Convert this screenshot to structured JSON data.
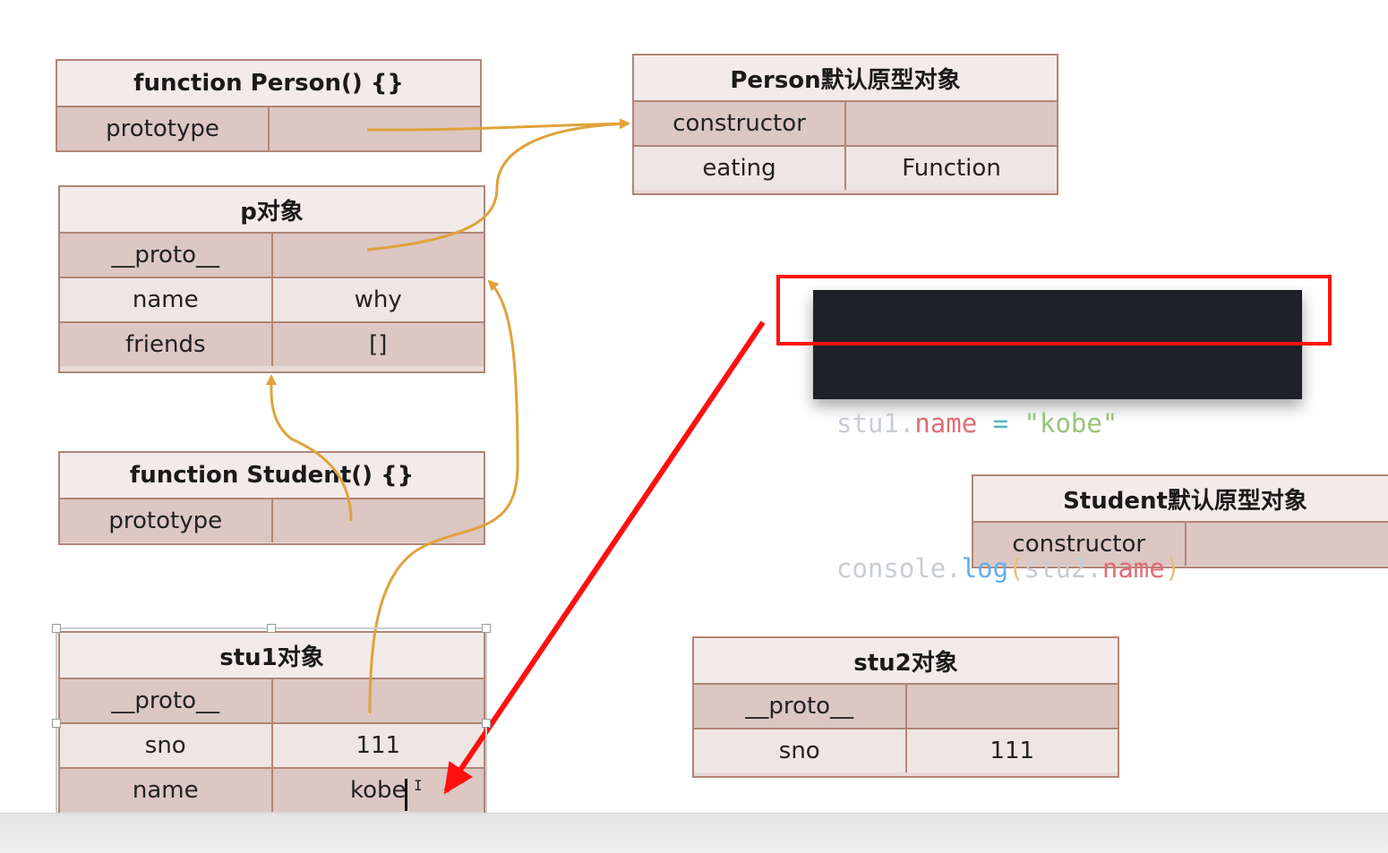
{
  "person_fn": {
    "title": "function Person() {}",
    "rows": [
      {
        "key": "prototype",
        "value": ""
      }
    ]
  },
  "person_proto": {
    "title": "Person默认原型对象",
    "rows": [
      {
        "key": "constructor",
        "value": ""
      },
      {
        "key": "eating",
        "value": "Function"
      }
    ]
  },
  "p_obj": {
    "title": "p对象",
    "rows": [
      {
        "key": "__proto__",
        "value": ""
      },
      {
        "key": "name",
        "value": "why"
      },
      {
        "key": "friends",
        "value": "[]"
      }
    ]
  },
  "student_fn": {
    "title": "function Student() {}",
    "rows": [
      {
        "key": "prototype",
        "value": ""
      }
    ]
  },
  "student_proto": {
    "title": "Student默认原型对象",
    "rows": [
      {
        "key": "constructor",
        "value": ""
      }
    ]
  },
  "stu1": {
    "title": "stu1对象",
    "rows": [
      {
        "key": "__proto__",
        "value": ""
      },
      {
        "key": "sno",
        "value": "111"
      },
      {
        "key": "name",
        "value": "kobe"
      }
    ]
  },
  "stu2": {
    "title": "stu2对象",
    "rows": [
      {
        "key": "__proto__",
        "value": ""
      },
      {
        "key": "sno",
        "value": "111"
      }
    ]
  },
  "code": {
    "line1": {
      "obj": "stu1",
      "dot": ".",
      "prop": "name",
      "op": " = ",
      "str": "\"kobe\""
    },
    "line2": {
      "obj": "console",
      "dot": ".",
      "fn": "log",
      "open": "(",
      "arg_obj": "stu2",
      "arg_dot": ".",
      "arg_prop": "name",
      "close": ")"
    }
  },
  "colors": {
    "box_border": "#b08676",
    "arrow": "#e0a23a",
    "highlight": "#ff1010",
    "code_bg": "#1e2127"
  }
}
